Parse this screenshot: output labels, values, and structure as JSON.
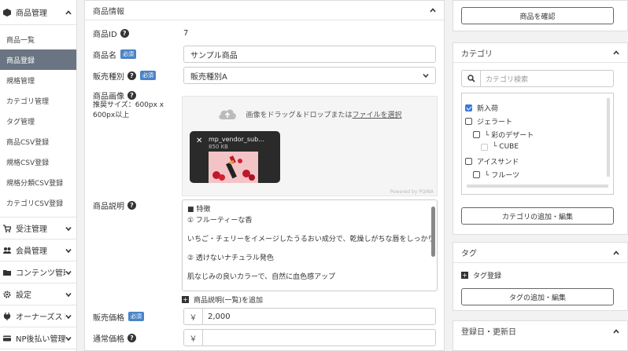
{
  "sidebar": {
    "header": "商品管理",
    "sub_items": [
      {
        "label": "商品一覧",
        "active": false
      },
      {
        "label": "商品登録",
        "active": true
      },
      {
        "label": "規格管理",
        "active": false
      },
      {
        "label": "カテゴリ管理",
        "active": false
      },
      {
        "label": "タグ管理",
        "active": false
      },
      {
        "label": "商品CSV登録",
        "active": false
      },
      {
        "label": "規格CSV登録",
        "active": false
      },
      {
        "label": "規格分類CSV登録",
        "active": false
      },
      {
        "label": "カテゴリCSV登録",
        "active": false
      }
    ],
    "groups": [
      {
        "label": "受注管理",
        "icon": "cart-icon"
      },
      {
        "label": "会員管理",
        "icon": "users-icon"
      },
      {
        "label": "コンテンツ管理",
        "icon": "folder-icon"
      },
      {
        "label": "設定",
        "icon": "gear-icon"
      },
      {
        "label": "オーナーズストア",
        "icon": "plug-icon"
      },
      {
        "label": "NP後払い管理",
        "icon": "card-icon"
      }
    ]
  },
  "main": {
    "panel_title": "商品情報",
    "product_id_label": "商品ID",
    "product_id": "7",
    "name_label": "商品名",
    "name_value": "サンプル商品",
    "required_badge": "必須",
    "sale_type_label": "販売種別",
    "sale_type_value": "販売種別A",
    "image_label": "商品画像",
    "image_hint": "推奨サイズ：600px x 600px以上",
    "drop_text": "画像をドラッグ＆ドロップまたは",
    "drop_link": "ファイルを選択",
    "thumb_filename": "mp_vendor_sub...",
    "thumb_size": "850 KB",
    "powered_by": "Powered by PQINA",
    "description_label": "商品説明",
    "description_lines": [
      "■ 特徴",
      "① フルーティーな香",
      "",
      "いちご・チェリーをイメージしたうるおい成分で、乾燥しがちな唇をしっかりケア。",
      "",
      "② 透けないナチュラル発色",
      "",
      "肌なじみの良いカラーで、自然に血色感アップ"
    ],
    "add_description_label": "商品説明(一覧)を追加",
    "price_label": "販売価格",
    "yen_symbol": "￥",
    "price_value": "2,000",
    "normal_price_label": "通常価格",
    "normal_price_value": ""
  },
  "right": {
    "confirm_button": "商品を確認",
    "category_title": "カテゴリ",
    "category_search_placeholder": "カテゴリ検索",
    "categories": [
      {
        "label": "新入荷",
        "checked": true,
        "level": 0
      },
      {
        "label": "ジェラート",
        "checked": false,
        "level": 0
      },
      {
        "label": "└ 彩のデザート",
        "checked": false,
        "level": 1
      },
      {
        "label": "└ CUBE",
        "checked": false,
        "level": 2
      },
      {
        "label": "アイスサンド",
        "checked": false,
        "level": 0
      },
      {
        "label": "└ フルーツ",
        "checked": false,
        "level": 1
      }
    ],
    "category_edit_button": "カテゴリの追加・編集",
    "tag_title": "タグ",
    "tag_register_label": "タグ登録",
    "tag_edit_button": "タグの追加・編集",
    "date_title": "登録日・更新日"
  },
  "colors": {
    "sidebar_active": "#6a7482",
    "required_badge": "#4a84c6",
    "checkbox_on": "#3b7ad9"
  }
}
